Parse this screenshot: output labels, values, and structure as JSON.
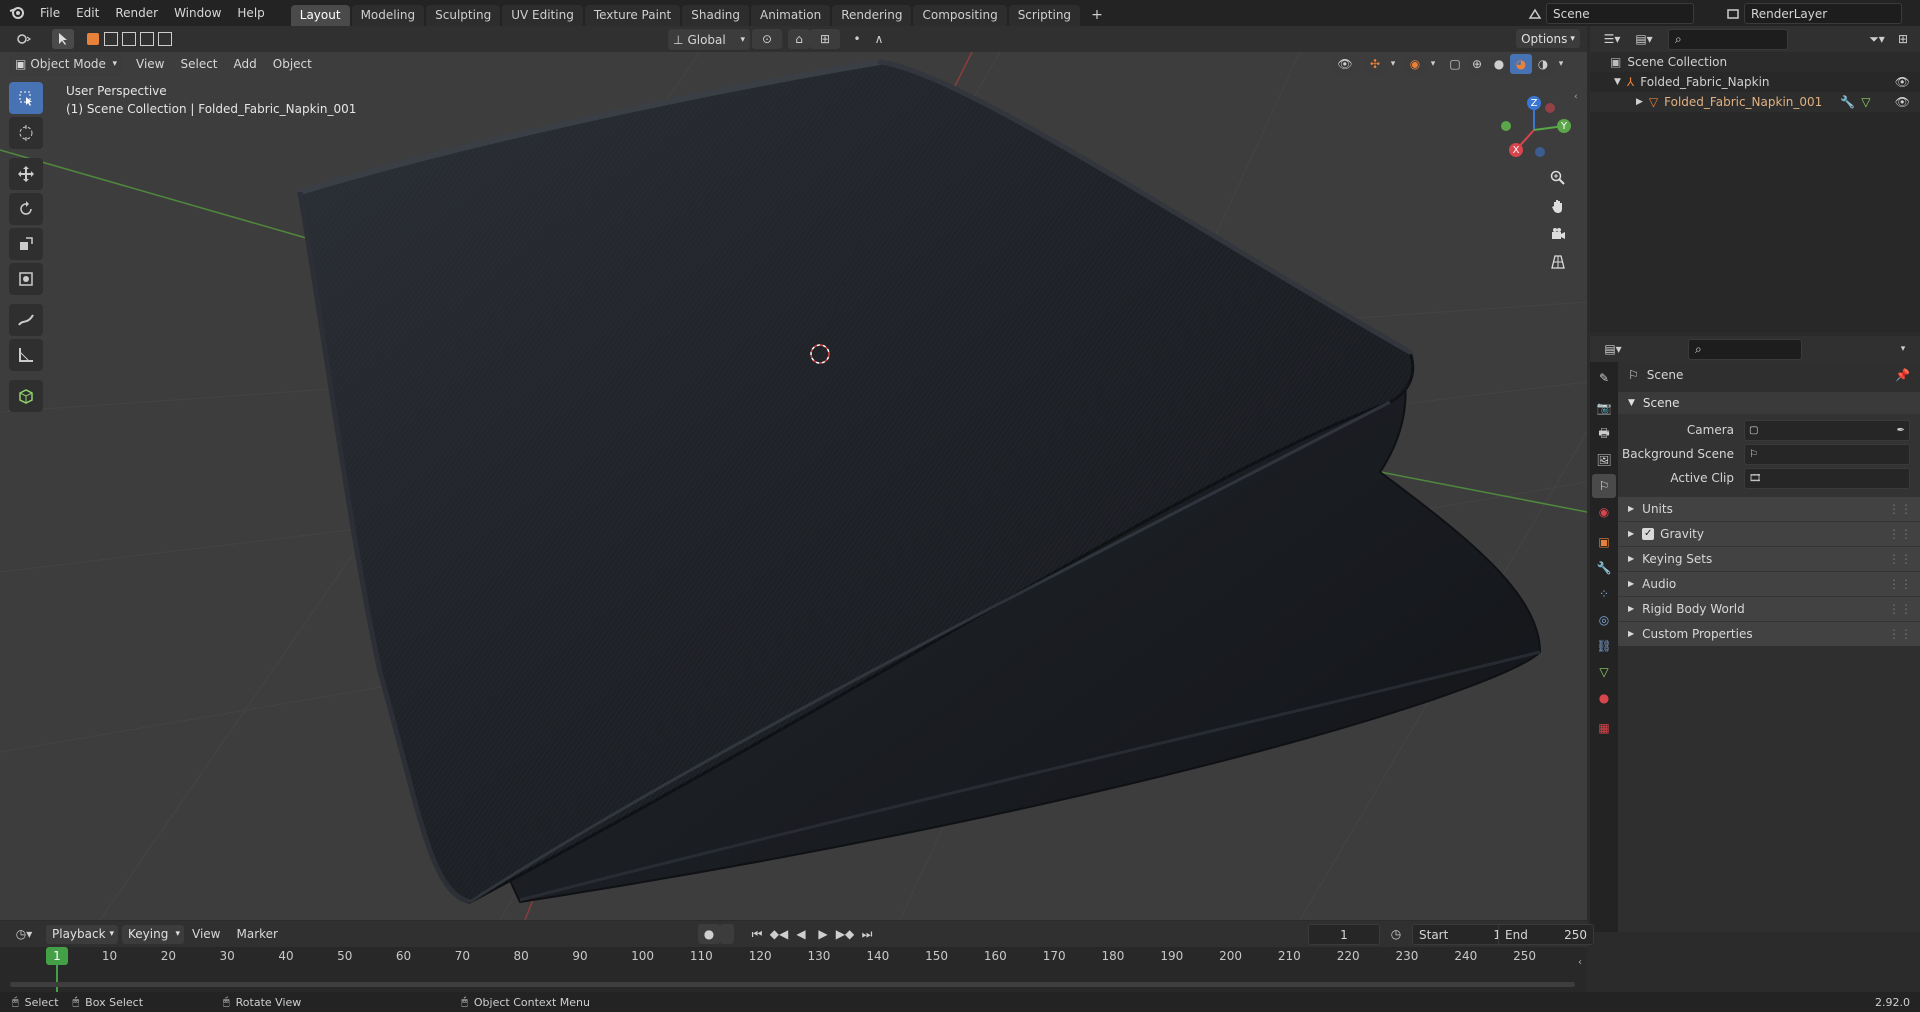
{
  "topbar": {
    "menus": [
      "File",
      "Edit",
      "Render",
      "Window",
      "Help"
    ],
    "workspaces": [
      "Layout",
      "Modeling",
      "Sculpting",
      "UV Editing",
      "Texture Paint",
      "Shading",
      "Animation",
      "Rendering",
      "Compositing",
      "Scripting"
    ],
    "active_workspace": "Layout",
    "add_workspace": "+",
    "scene_name": "Scene",
    "view_layer": "RenderLayer"
  },
  "viewport_header": {
    "mode": "Object Mode",
    "menus": [
      "View",
      "Select",
      "Add",
      "Object"
    ],
    "transform_orientation": "Global",
    "options_label": "Options"
  },
  "viewport": {
    "view_name": "User Perspective",
    "view_context": "(1) Scene Collection | Folded_Fabric_Napkin_001",
    "axes": {
      "x": "X",
      "y": "Y",
      "z": "Z"
    }
  },
  "outliner": {
    "root": "Scene Collection",
    "collection": "Folded_Fabric_Napkin",
    "object": "Folded_Fabric_Napkin_001"
  },
  "properties": {
    "context": "Scene",
    "panel_title": "Scene",
    "fields": [
      {
        "label": "Camera",
        "value": ""
      },
      {
        "label": "Background Scene",
        "value": ""
      },
      {
        "label": "Active Clip",
        "value": ""
      }
    ],
    "subpanels": [
      "Units",
      "Gravity",
      "Keying Sets",
      "Audio",
      "Rigid Body World",
      "Custom Properties"
    ],
    "gravity_checked": true
  },
  "timeline": {
    "menus": [
      "Playback",
      "Keying",
      "View",
      "Marker"
    ],
    "current_frame": "1",
    "start_label": "Start",
    "start_value": "1",
    "end_label": "End",
    "end_value": "250",
    "ticks": [
      "10",
      "20",
      "30",
      "40",
      "50",
      "60",
      "70",
      "80",
      "90",
      "100",
      "110",
      "120",
      "130",
      "140",
      "150",
      "160",
      "170",
      "180",
      "190",
      "200",
      "210",
      "220",
      "230",
      "240",
      "250"
    ],
    "playhead_label": "1"
  },
  "statusbar": {
    "select": "Select",
    "box_select": "Box Select",
    "rotate_view": "Rotate View",
    "context_menu": "Object Context Menu",
    "version": "2.92.0"
  },
  "colors": {
    "accent": "#4772b3",
    "orange": "#e8813a",
    "playhead": "#43a047"
  }
}
